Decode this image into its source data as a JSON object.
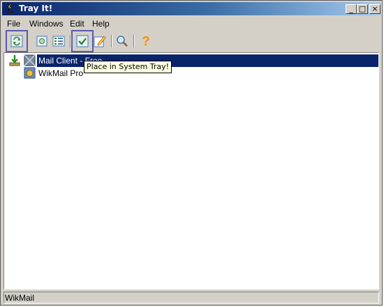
{
  "window": {
    "title": "Tray It!"
  },
  "title_buttons": {
    "minimize": "_",
    "maximize": "□",
    "close": "×"
  },
  "menu": {
    "items": [
      "File",
      "Windows",
      "Edit",
      "Help"
    ]
  },
  "toolbar": {
    "buttons": [
      {
        "icon": "refresh-icon"
      },
      {
        "icon": "properties-icon"
      },
      {
        "icon": "list-view-icon"
      },
      {
        "icon": "check-icon"
      },
      {
        "icon": "edit-icon"
      },
      {
        "icon": "search-icon"
      },
      {
        "icon": "help-icon",
        "label": "?"
      }
    ]
  },
  "tree": {
    "items": [
      {
        "label": "Mail Client - Free",
        "selected": true,
        "icon": "mail-client-icon"
      },
      {
        "label": "WikMail Pro",
        "selected": false,
        "icon": "wikmail-icon"
      }
    ]
  },
  "tooltip": {
    "text": "Place in System Tray!"
  },
  "status": {
    "text": "WikMail"
  },
  "colors": {
    "title_start": "#0a246a",
    "title_end": "#a6caf0",
    "selection": "#0a246a",
    "tooltip_bg": "#ffffe1",
    "chrome": "#d4d0c8",
    "help": "#ff8a00"
  }
}
